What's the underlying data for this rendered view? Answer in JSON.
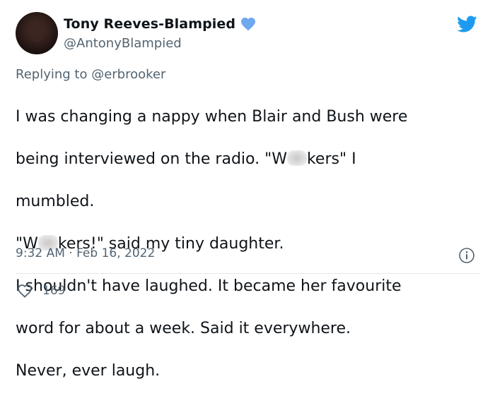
{
  "author": {
    "display_name": "Tony Reeves-Blampied",
    "handle": "@AntonyBlampied"
  },
  "reply": {
    "prefix": "Replying to ",
    "mention": "@erbrooker"
  },
  "body": {
    "line1": "I was changing a nappy when Blair and Bush were",
    "line2_a": "being interviewed on the radio. \"W",
    "line2_b": "kers\" I",
    "line3": "mumbled.",
    "line4_a": "\"W",
    "line4_b": "kers!\" said my tiny daughter.",
    "line5": "I shouldn't have laughed. It became her favourite",
    "line6": "word for about a week. Said it everywhere.",
    "line7": "Never, ever laugh."
  },
  "meta": {
    "timestamp": "9:32 AM · Feb 16, 2022"
  },
  "stats": {
    "likes": "169"
  },
  "icons": {
    "verified": "verified-badge-icon",
    "brand": "twitter-bird-icon",
    "info": "info-icon",
    "like": "heart-icon"
  },
  "colors": {
    "brand": "#1d9bf0",
    "text": "#0f1419",
    "secondary": "#536471"
  }
}
